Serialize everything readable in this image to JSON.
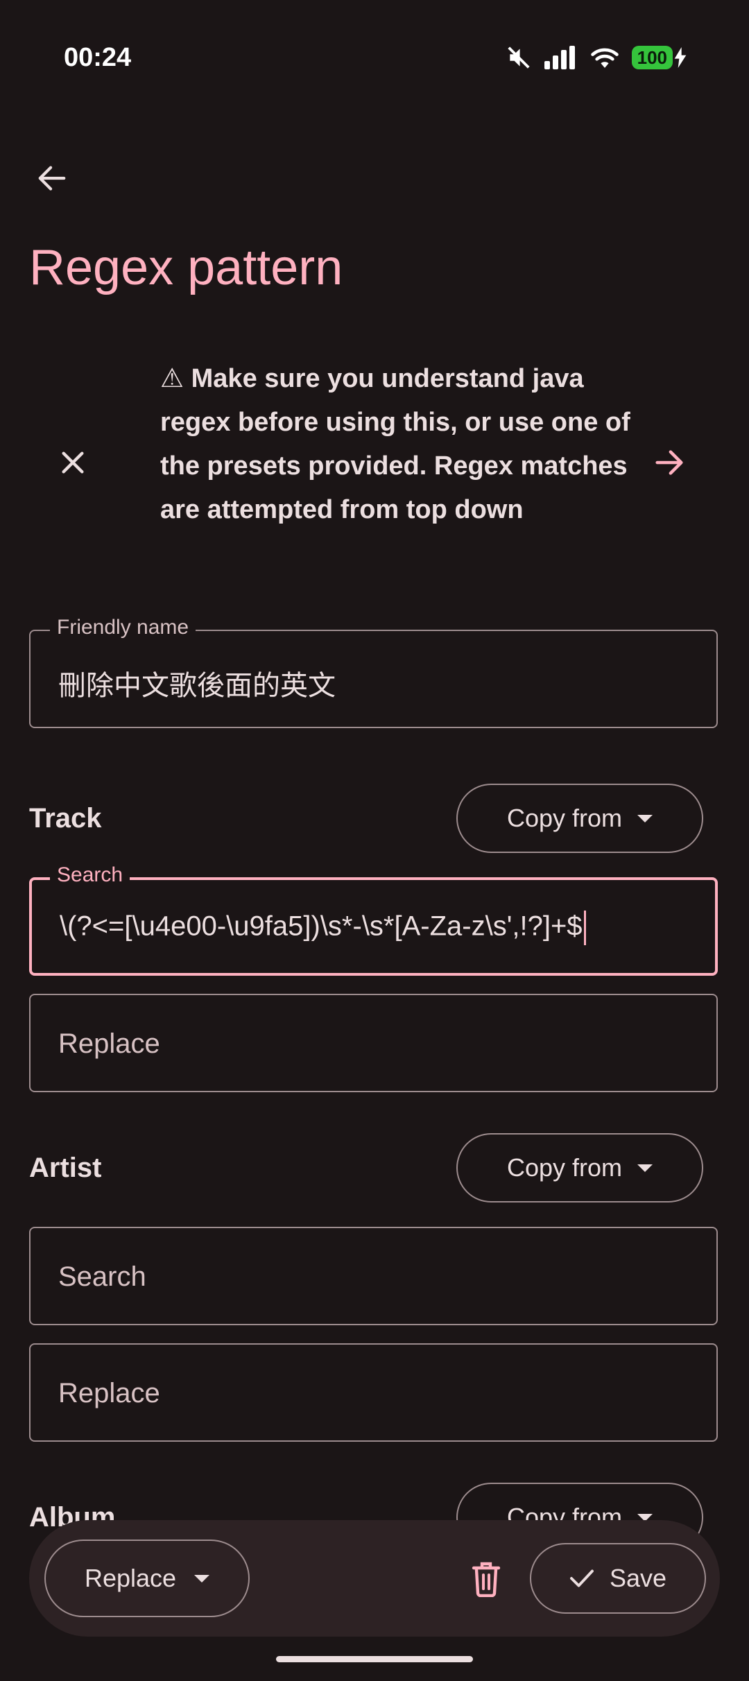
{
  "status_bar": {
    "time": "00:24",
    "battery": "100"
  },
  "header": {
    "title": "Regex pattern"
  },
  "warning": {
    "icon": "⚠",
    "text": "Make sure you understand java regex before using this, or use one of the presets provided. Regex matches are attempted from top down"
  },
  "friendly_name": {
    "label": "Friendly name",
    "value": "刪除中文歌後面的英文"
  },
  "track": {
    "label": "Track",
    "copy_from": "Copy from",
    "search_label": "Search",
    "search_value": "\\(?<=[\\u4e00-\\u9fa5])\\s*-\\s*[A-Za-z\\s',!?]+$",
    "replace_placeholder": "Replace"
  },
  "artist": {
    "label": "Artist",
    "copy_from": "Copy from",
    "search_placeholder": "Search",
    "replace_placeholder": "Replace"
  },
  "album": {
    "label": "Album",
    "copy_from": "Copy from"
  },
  "bottom_bar": {
    "mode": "Replace",
    "save": "Save"
  },
  "colors": {
    "accent": "#ffb1c0",
    "background": "#1b1516",
    "surface": "#2d2224",
    "outline": "#9d8c8e"
  }
}
